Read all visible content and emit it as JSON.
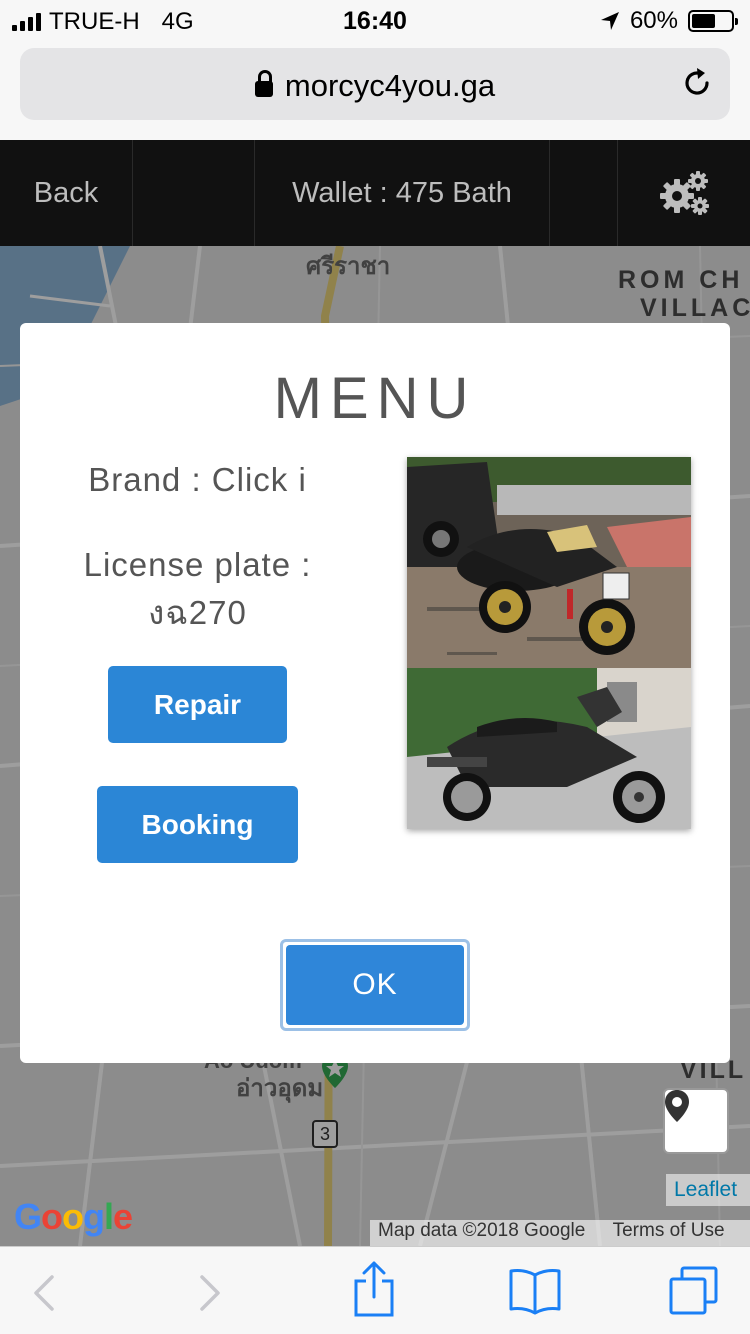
{
  "status_bar": {
    "carrier": "TRUE-H",
    "network": "4G",
    "time": "16:40",
    "battery_percent": "60%",
    "battery_level": 0.6
  },
  "browser": {
    "url": "morcyc4you.ga"
  },
  "header": {
    "back_label": "Back",
    "wallet_label": "Wallet : 475 Bath"
  },
  "map": {
    "labels": [
      "ศรีราชา",
      "ROM CH",
      "VILLAC",
      "อ่าวอุดม",
      "Ao Udom",
      "3",
      "VILL"
    ],
    "attribution": "Map data ©2018 Google",
    "terms": "Terms of Use",
    "leaflet": "Leaflet",
    "google": "Google"
  },
  "modal": {
    "title": "MENU",
    "brand_text": "Brand : Click i",
    "plate_label": "License plate :",
    "plate_value": "งฉ270",
    "repair_label": "Repair",
    "booking_label": "Booking",
    "ok_label": "OK"
  },
  "colors": {
    "accent": "#2b86d6",
    "header_bg": "#111111",
    "google_blue": "#4285F4",
    "google_red": "#EA4335",
    "google_yellow": "#FBBC05",
    "google_green": "#34A853"
  }
}
